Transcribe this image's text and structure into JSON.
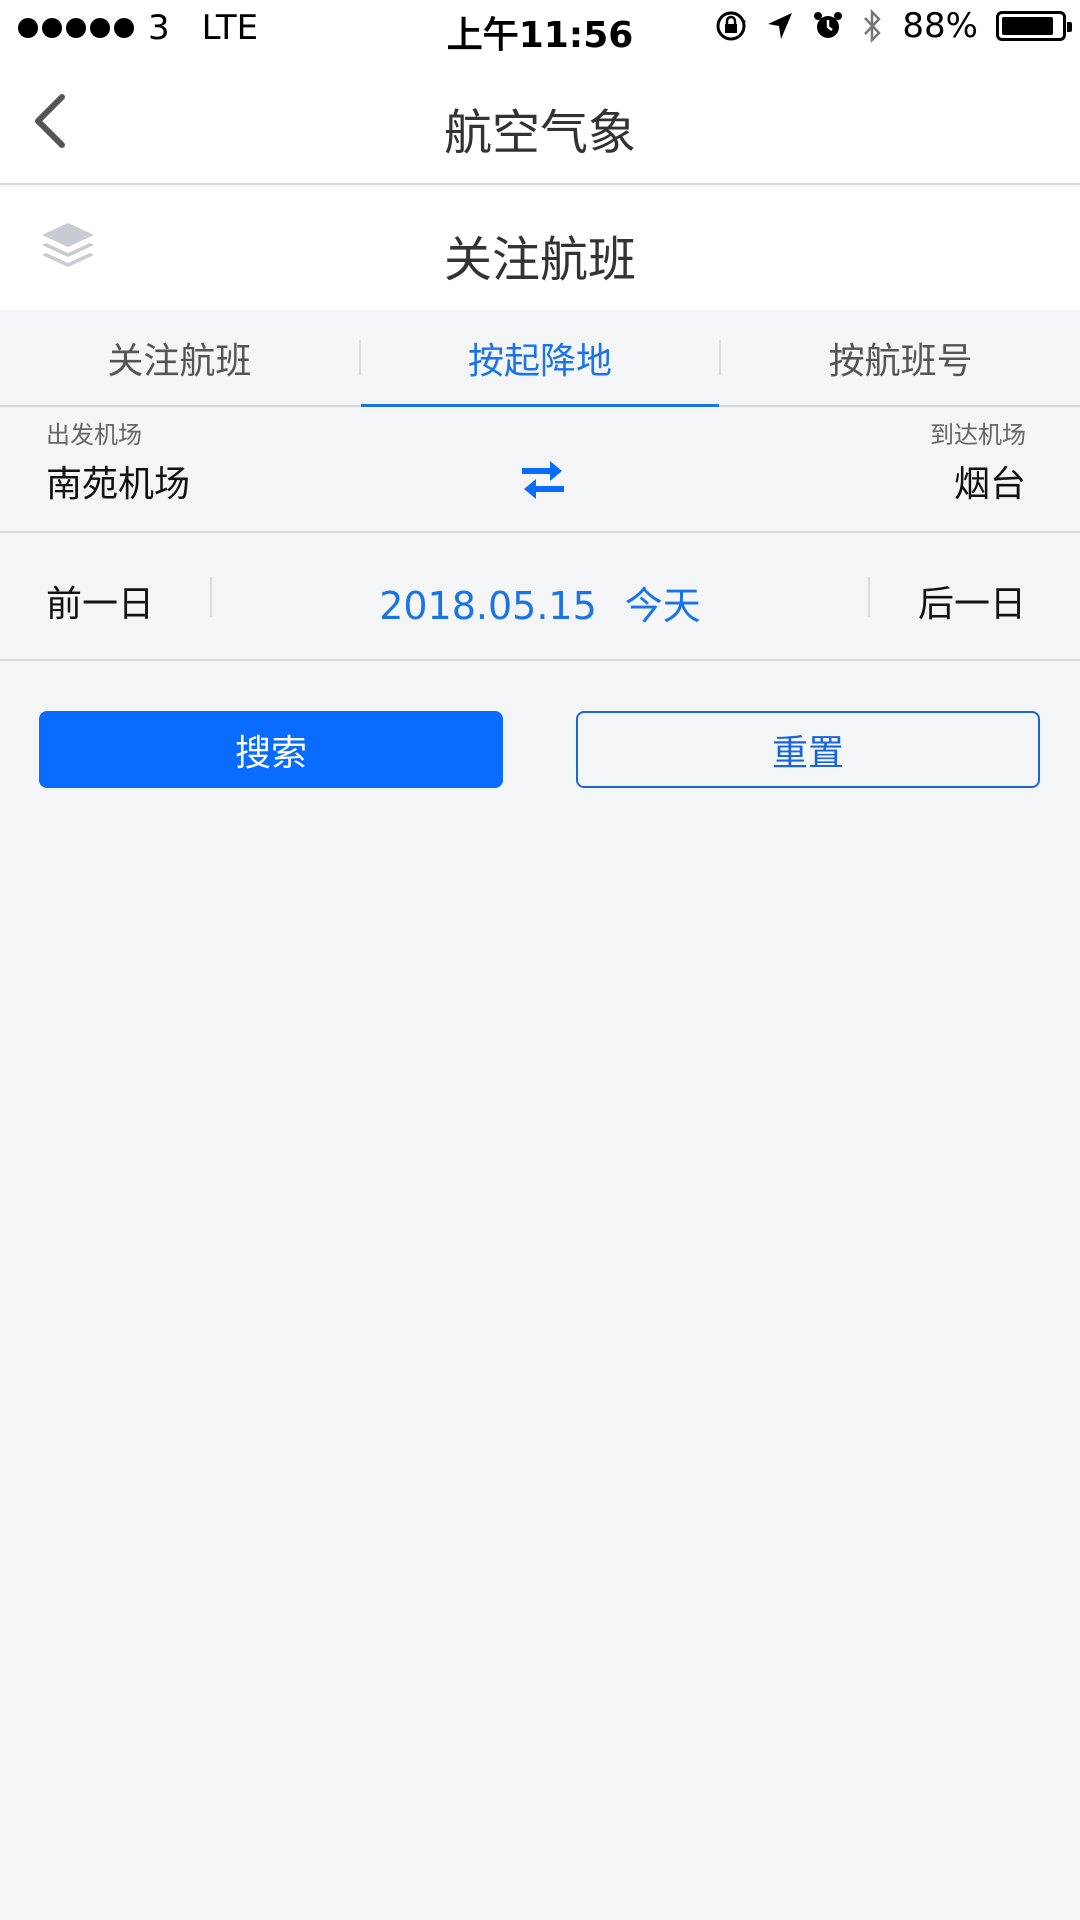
{
  "status_bar": {
    "carrier": "3",
    "network": "LTE",
    "time": "上午11:56",
    "battery": "88%",
    "battery_level": 0.88
  },
  "nav": {
    "title": "航空气象"
  },
  "sub_header": {
    "title": "关注航班"
  },
  "tabs": [
    {
      "label": "关注航班",
      "active": false
    },
    {
      "label": "按起降地",
      "active": true
    },
    {
      "label": "按航班号",
      "active": false
    }
  ],
  "airports": {
    "departure_label": "出发机场",
    "departure_value": "南苑机场",
    "arrival_label": "到达机场",
    "arrival_value": "烟台"
  },
  "date_selector": {
    "prev_label": "前一日",
    "date": "2018.05.15",
    "today_label": "今天",
    "next_label": "后一日"
  },
  "actions": {
    "search_label": "搜索",
    "reset_label": "重置"
  },
  "colors": {
    "accent": "#1a73e8",
    "primary_button": "#0a6cff",
    "background": "#f4f5f7"
  }
}
